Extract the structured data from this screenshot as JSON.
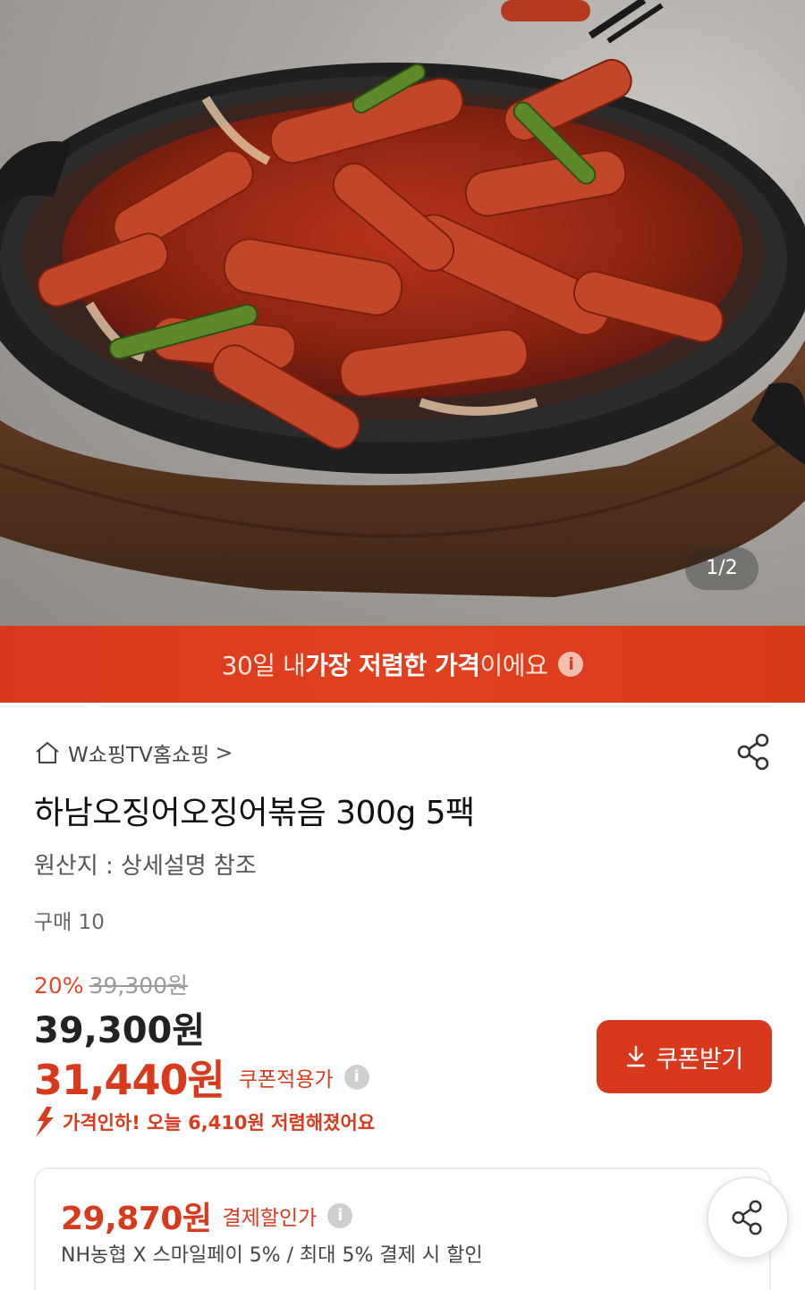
{
  "hero": {
    "page_counter": "1/2"
  },
  "banner": {
    "prefix": "30일 내 ",
    "highlight": "가장 저렴한 가격",
    "suffix": "이에요",
    "info_glyph": "i"
  },
  "store": {
    "name": "W쇼핑TV홈쇼핑",
    "chevron": ">",
    "home_icon": "home-icon",
    "share_icon": "share-icon"
  },
  "product": {
    "title": "하남오징어오징어볶음 300g 5팩",
    "origin": "원산지 : 상세설명 참조",
    "purchase_count": "구매 10"
  },
  "pricing": {
    "discount_rate": "20%",
    "original_price": "39,300원",
    "sale_price": "39,300원",
    "coupon_price": "31,440원",
    "coupon_label": "쿠폰적용가",
    "price_drop_text": "가격인하! 오늘 6,410원 저렴해졌어요",
    "coupon_button": "쿠폰받기"
  },
  "payment": {
    "price": "29,870원",
    "label": "결제할인가",
    "detail": "NH농협 X 스마일페이 5%  / 최대 5% 결제 시 할인"
  },
  "colors": {
    "accent": "#d83a1e",
    "banner": "#e0401f",
    "muted": "#9a9a9a"
  }
}
